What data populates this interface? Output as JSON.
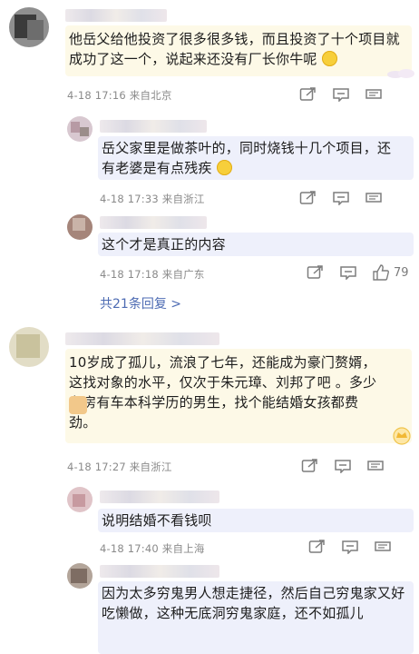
{
  "comments": [
    {
      "text": "他岳父给他投资了很多很多钱，而且投资了十个项目就成功了这一个，说起来还没有厂长你牛呢",
      "meta": "4-18 17:16 来自北京",
      "replies": [
        {
          "text": "岳父家里是做茶叶的，同时烧钱十几个项目，还有老婆是有点残疾",
          "meta": "4-18 17:33 来自浙江"
        },
        {
          "text": "这个才是真正的内容",
          "meta": "4-18 17:18 来自广东",
          "likes": "79"
        }
      ],
      "more_replies": "共21条回复 >"
    },
    {
      "text": "10岁成了孤儿，流浪了七年，还能成为豪门赘婿，这找对象的水平，仅次于朱元璋、刘邦了吧 。多少有房有车本科学历的男生，找个能结婚女孩都费劲。",
      "meta": "4-18 17:27 来自浙江",
      "replies": [
        {
          "text": "说明结婚不看钱呗",
          "meta": "4-18 17:40 来自上海"
        },
        {
          "text": "因为太多穷鬼男人想走捷径，然后自己穷鬼家又好吃懒做，这种无底洞穷鬼家庭，还不如孤儿"
        }
      ]
    }
  ],
  "icons": [
    "share-icon",
    "comment-icon",
    "like-icon"
  ],
  "colors": {
    "main_bubble": "#fdf9e7",
    "reply_bubble": "#eef0fb",
    "link": "#4d6bb3",
    "meta": "#8a8a8a"
  }
}
